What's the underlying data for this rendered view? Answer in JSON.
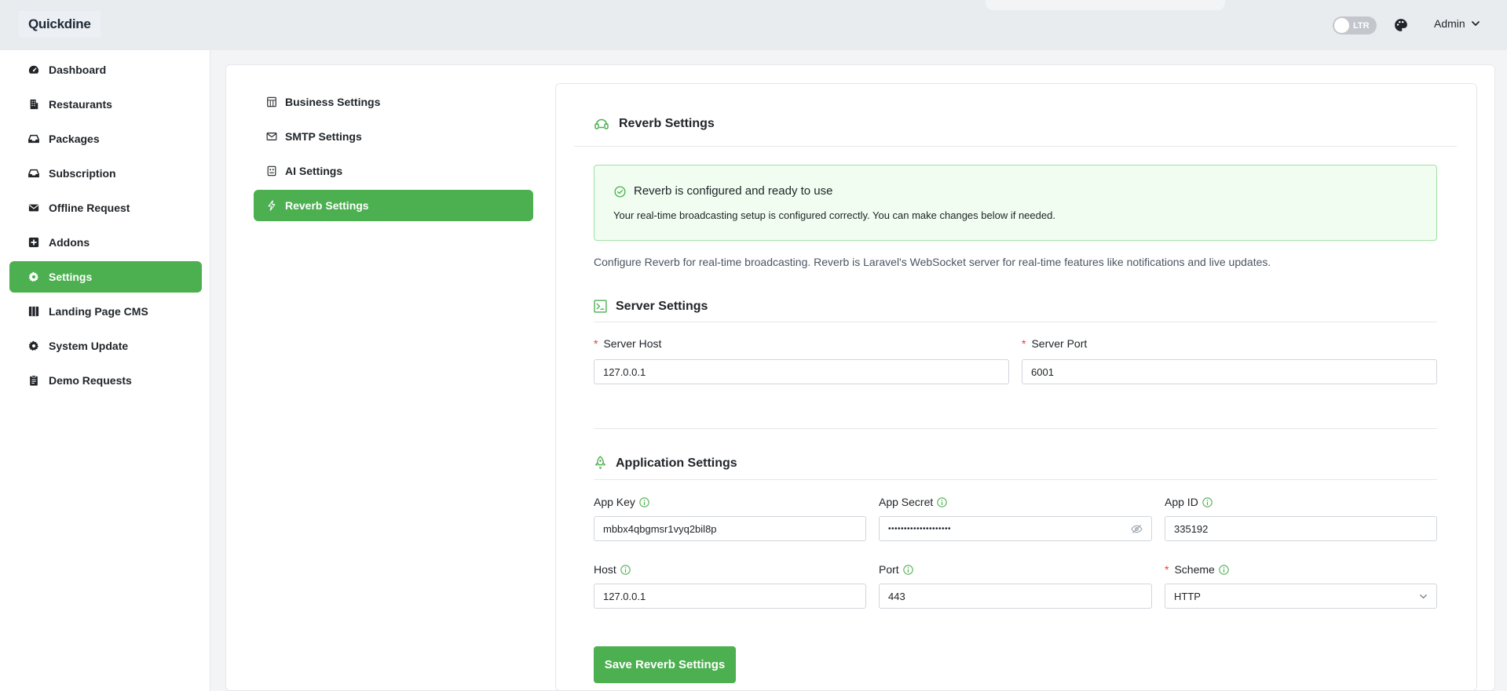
{
  "header": {
    "logo": "Quickdine",
    "direction_toggle": "LTR",
    "user_menu": "Admin"
  },
  "sidebar": {
    "items": [
      {
        "label": "Dashboard",
        "icon": "dashboard-icon"
      },
      {
        "label": "Restaurants",
        "icon": "building-icon"
      },
      {
        "label": "Packages",
        "icon": "inbox-icon"
      },
      {
        "label": "Subscription",
        "icon": "inbox-icon"
      },
      {
        "label": "Offline Request",
        "icon": "envelope-icon"
      },
      {
        "label": "Addons",
        "icon": "plus-square-icon"
      },
      {
        "label": "Settings",
        "icon": "gear-icon",
        "active": true
      },
      {
        "label": "Landing Page CMS",
        "icon": "columns-icon"
      },
      {
        "label": "System Update",
        "icon": "gear-icon"
      },
      {
        "label": "Demo Requests",
        "icon": "clipboard-icon"
      }
    ]
  },
  "settings_nav": {
    "items": [
      {
        "label": "Business Settings",
        "icon": "building-outline-icon"
      },
      {
        "label": "SMTP Settings",
        "icon": "mail-icon"
      },
      {
        "label": "AI Settings",
        "icon": "robot-icon"
      },
      {
        "label": "Reverb Settings",
        "icon": "lightning-icon",
        "active": true
      }
    ]
  },
  "panel": {
    "title": "Reverb Settings",
    "alert": {
      "title": "Reverb is configured and ready to use",
      "message": "Your real-time broadcasting setup is configured correctly. You can make changes below if needed."
    },
    "description": "Configure Reverb for real-time broadcasting. Reverb is Laravel's WebSocket server for real-time features like notifications and live updates.",
    "server_settings": {
      "title": "Server Settings",
      "host_label": "Server Host",
      "host_value": "127.0.0.1",
      "port_label": "Server Port",
      "port_value": "6001"
    },
    "application_settings": {
      "title": "Application Settings",
      "app_key_label": "App Key",
      "app_key_value": "mbbx4qbgmsr1vyq2bil8p",
      "app_secret_label": "App Secret",
      "app_secret_value": "••••••••••••••••••••",
      "app_id_label": "App ID",
      "app_id_value": "335192",
      "host_label": "Host",
      "host_value": "127.0.0.1",
      "port_label": "Port",
      "port_value": "443",
      "scheme_label": "Scheme",
      "scheme_value": "HTTP"
    },
    "save_button": "Save Reverb Settings"
  },
  "colors": {
    "accent": "#4caf50",
    "alert_bg": "#f0fdf0",
    "alert_border": "#a3e0a5",
    "required": "#e53935"
  }
}
